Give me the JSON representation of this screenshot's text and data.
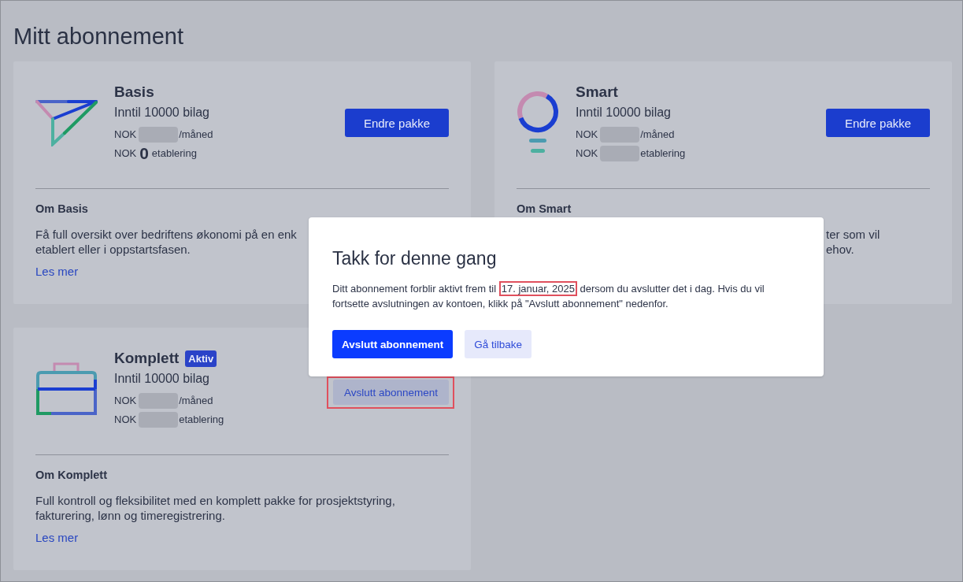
{
  "page": {
    "title": "Mitt abonnement"
  },
  "plans": [
    {
      "name": "Basis",
      "vouchers": "Inntil 10000 bilag",
      "price_lines": [
        {
          "currency": "NOK",
          "blurred": true,
          "unit": "/måned"
        },
        {
          "currency": "NOK",
          "blurred": false,
          "amount": "0",
          "unit": "etablering"
        }
      ],
      "button": {
        "label": "Endre pakke",
        "kind": "primary",
        "highlighted": false
      },
      "about_heading": "Om Basis",
      "description_lines": [
        "Få full oversikt over bedriftens økonomi på en enk",
        "etablert eller i oppstartsfasen."
      ],
      "link": "Les mer"
    },
    {
      "name": "Smart",
      "vouchers": "Inntil 10000 bilag",
      "price_lines": [
        {
          "currency": "NOK",
          "blurred": true,
          "unit": "/måned"
        },
        {
          "currency": "NOK",
          "blurred": true,
          "unit": "etablering"
        }
      ],
      "button": {
        "label": "Endre pakke",
        "kind": "primary",
        "highlighted": false
      },
      "about_heading": "Om Smart",
      "description_lines": [
        "ter som vil",
        "ehov."
      ]
    },
    {
      "name": "Komplett",
      "badge": "Aktiv",
      "vouchers": "Inntil 10000 bilag",
      "price_lines": [
        {
          "currency": "NOK",
          "blurred": true,
          "unit": "/måned"
        },
        {
          "currency": "NOK",
          "blurred": true,
          "unit": "etablering"
        }
      ],
      "button": {
        "label": "Avslutt abonnement",
        "kind": "secondary",
        "highlighted": true
      },
      "about_heading": "Om Komplett",
      "description_lines": [
        "Full kontroll og fleksibilitet med en komplett pakke for prosjektstyring,",
        "fakturering, lønn og timeregistrering."
      ],
      "link": "Les mer"
    }
  ],
  "dialog": {
    "title": "Takk for denne gang",
    "message": [
      {
        "text": "Ditt abonnement forblir aktivt frem til ",
        "highlighted": false
      },
      {
        "text": "17. januar, 2025",
        "highlighted": true
      },
      {
        "text": " dersom du avslutter det i dag. Hvis du vil fortsette avslutningen av kontoen, klikk på \"Avslutt abonnement\" nedenfor.",
        "highlighted": false
      }
    ],
    "buttons": [
      {
        "label": "Avslutt abonnement",
        "kind": "primary"
      },
      {
        "label": "Gå tilbake",
        "kind": "secondary"
      }
    ]
  }
}
